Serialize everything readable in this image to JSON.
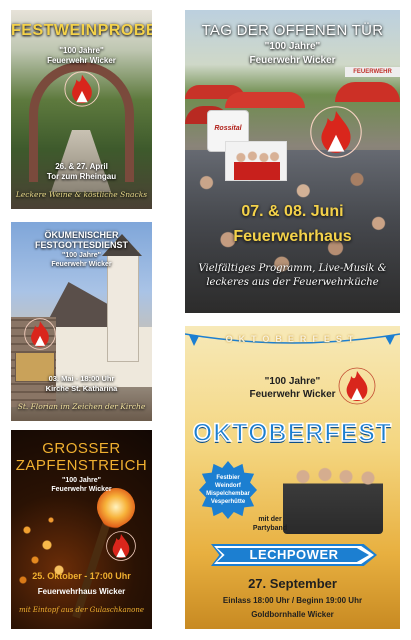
{
  "posters": {
    "festweinprobe": {
      "title": "FESTWEINPROBE",
      "subtitle_line1": "\"100 Jahre\"",
      "subtitle_line2": "Feuerwehr Wicker",
      "date": "26. & 27. April",
      "place": "Tor zum Rheingau",
      "tagline": "Leckere Weine & köstliche Snacks"
    },
    "open_day": {
      "title": "TAG DER OFFENEN TÜR",
      "subtitle_line1": "\"100 Jahre\"",
      "subtitle_line2": "Feuerwehr Wicker",
      "band_logo_text": "Rossital",
      "date": "07. & 08. Juni",
      "place": "Feuerwehrhaus",
      "tagline": "Vielfältiges Programm, Live-Musik & leckeres aus der Feuerwehrküche",
      "sign_text": "FEUERWEHR"
    },
    "gottesdienst": {
      "title_line1": "ÖKUMENISCHER",
      "title_line2": "FESTGOTTESDIENST",
      "subtitle_line1": "\"100 Jahre\"",
      "subtitle_line2": "Feuerwehr Wicker",
      "date_time": "03. Mai - 18:00 Uhr",
      "place": "Kirche St. Katharina",
      "tagline": "St. Florian im Zeichen der Kirche"
    },
    "zapfenstreich": {
      "title_line1": "GROSSER",
      "title_line2": "ZAPFENSTREICH",
      "subtitle_line1": "\"100 Jahre\"",
      "subtitle_line2": "Feuerwehr Wicker",
      "date_time": "25. Oktober - 17:00 Uhr",
      "place": "Feuerwehrhaus Wicker",
      "tagline": "mit Eintopf aus der Gulaschkanone"
    },
    "oktoberfest": {
      "banner_text": "OKTOBERFEST",
      "subtitle_line1": "\"100 Jahre\"",
      "subtitle_line2": "Feuerwehr Wicker",
      "title": "OKTOBERFEST",
      "badge_line1": "Festbier",
      "badge_line2": "Weindorf",
      "badge_line3": "Mispelchembar",
      "badge_line4": "Vesperhütte",
      "party_text_line1": "mit der",
      "party_text_line2": "Partyband",
      "band_name": "LECHPOWER",
      "date": "27. September",
      "times": "Einlass 18:00 Uhr / Beginn 19:00 Uhr",
      "place": "Goldbornhalle Wicker"
    }
  },
  "colors": {
    "flame_red": "#d9261c",
    "gold": "#f4d24a",
    "oktober_blue": "#1c7fd1",
    "zapfen_orange": "#f0b030"
  }
}
